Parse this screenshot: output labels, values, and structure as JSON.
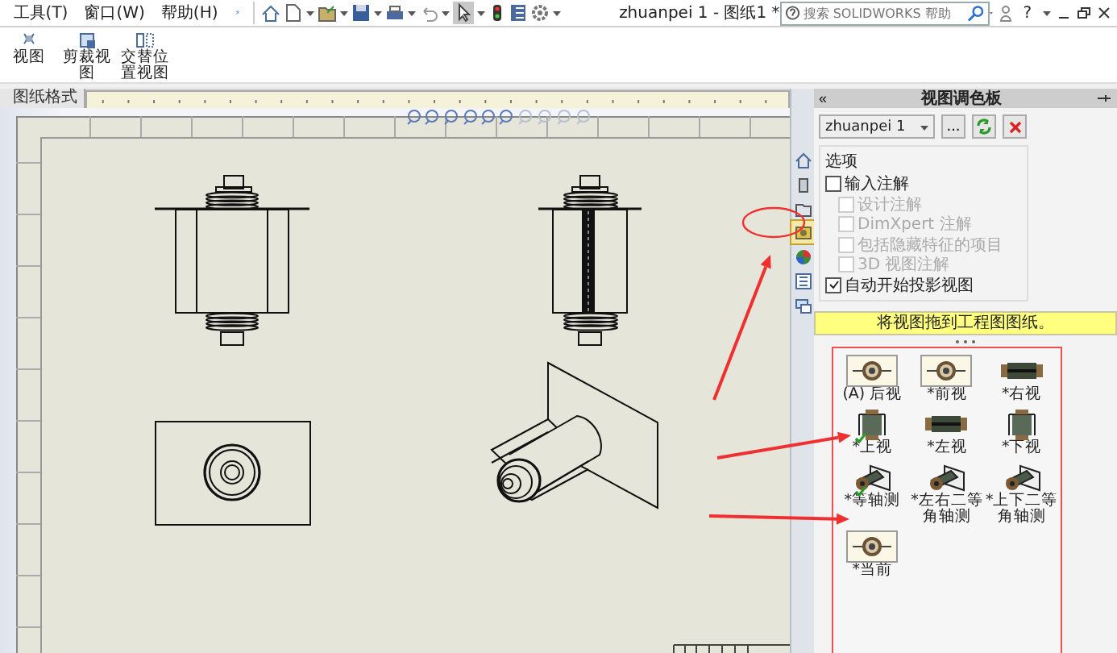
{
  "menu": [
    {
      "label": "工具(T)"
    },
    {
      "label": "窗口(W)"
    },
    {
      "label": "帮助(H)"
    }
  ],
  "title": "zhuanpei 1 - 图纸1 *",
  "search": {
    "placeholder": "搜索 SOLIDWORKS 帮助"
  },
  "help": "?",
  "ribbon": [
    {
      "label": "视图",
      "kind": "broken"
    },
    {
      "label": "剪裁视图",
      "kind": "crop"
    },
    {
      "label": "交替位置视图",
      "kind": "alternate"
    }
  ],
  "sheet_tabs": [
    {
      "label": "图纸格式",
      "selected": true
    }
  ],
  "side_tabs": [
    {
      "kind": "home",
      "selected": false
    },
    {
      "kind": "part",
      "selected": false
    },
    {
      "kind": "folder",
      "selected": false
    },
    {
      "kind": "palette",
      "selected": true
    },
    {
      "kind": "appearance",
      "selected": false
    },
    {
      "kind": "properties",
      "selected": false
    },
    {
      "kind": "custom",
      "selected": false
    }
  ],
  "palette": {
    "collapse": "«",
    "title": "视图调色板",
    "model": "zhuanpei 1",
    "browse": "...",
    "options_title": "选项",
    "options": [
      {
        "label": "输入注解",
        "checked": false,
        "disabled": false,
        "indent": false
      },
      {
        "label": "设计注解",
        "checked": false,
        "disabled": true,
        "indent": true
      },
      {
        "label": "DimXpert 注解",
        "checked": false,
        "disabled": true,
        "indent": true
      },
      {
        "label": "包括隐藏特征的项目",
        "checked": false,
        "disabled": true,
        "indent": true
      },
      {
        "label": "3D 视图注解",
        "checked": false,
        "disabled": true,
        "indent": true
      },
      {
        "label": "自动开始投影视图",
        "checked": true,
        "disabled": false,
        "indent": false
      }
    ],
    "hint": "将视图拖到工程图图纸。",
    "views": [
      {
        "label": "(A) 后视",
        "kind": "end",
        "highlighted": true,
        "placed": false
      },
      {
        "label": "*前视",
        "kind": "end",
        "highlighted": true,
        "placed": false
      },
      {
        "label": "*右视",
        "kind": "side",
        "highlighted": false,
        "placed": false
      },
      {
        "label": "*上视",
        "kind": "upright",
        "highlighted": false,
        "placed": true
      },
      {
        "label": "*左视",
        "kind": "side",
        "highlighted": false,
        "placed": false
      },
      {
        "label": "*下视",
        "kind": "upright",
        "highlighted": false,
        "placed": false
      },
      {
        "label": "*等轴测",
        "kind": "iso",
        "highlighted": false,
        "placed": true
      },
      {
        "label": "*左右二等角轴测",
        "kind": "iso",
        "highlighted": false,
        "placed": false
      },
      {
        "label": "*上下二等角轴测",
        "kind": "iso",
        "highlighted": false,
        "placed": false
      },
      {
        "label": "*当前",
        "kind": "end",
        "highlighted": true,
        "placed": false
      }
    ]
  }
}
